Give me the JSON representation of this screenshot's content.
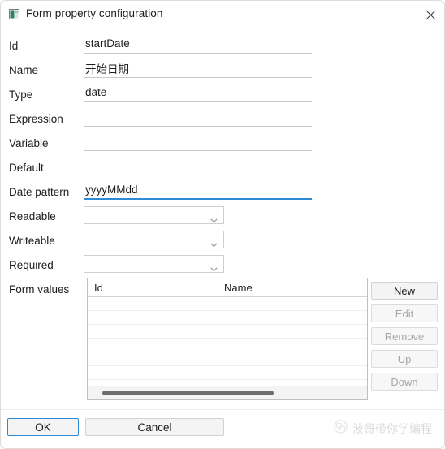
{
  "window": {
    "title": "Form property configuration",
    "icon": "app-window-icon",
    "close_icon": "close-icon",
    "accent_color": "#2f8ad6",
    "background": "#ffffff"
  },
  "form": {
    "rows": [
      {
        "label": "Id",
        "control": "text",
        "value": "startDate",
        "placeholder": "",
        "focused": false
      },
      {
        "label": "Name",
        "control": "text",
        "value": "开始日期",
        "placeholder": "",
        "focused": false
      },
      {
        "label": "Type",
        "control": "text",
        "value": "date",
        "placeholder": "",
        "focused": false
      },
      {
        "label": "Expression",
        "control": "text",
        "value": "",
        "placeholder": "",
        "focused": false
      },
      {
        "label": "Variable",
        "control": "text",
        "value": "",
        "placeholder": "",
        "focused": false
      },
      {
        "label": "Default",
        "control": "text",
        "value": "",
        "placeholder": "",
        "focused": false
      },
      {
        "label": "Date pattern",
        "control": "text",
        "value": "yyyyMMdd",
        "placeholder": "",
        "focused": true
      },
      {
        "label": "Readable",
        "control": "combo",
        "value": "",
        "placeholder": "",
        "focused": false
      },
      {
        "label": "Writeable",
        "control": "combo",
        "value": "",
        "placeholder": "",
        "focused": false
      },
      {
        "label": "Required",
        "control": "combo",
        "value": "",
        "placeholder": "",
        "focused": false
      }
    ],
    "form_values_label": "Form values"
  },
  "table": {
    "columns": [
      "Id",
      "Name"
    ],
    "rows": [],
    "empty_row_count": 6,
    "scrollbar": {
      "orientation": "horizontal",
      "visible": true
    }
  },
  "side_buttons": [
    {
      "label": "New",
      "enabled": true
    },
    {
      "label": "Edit",
      "enabled": false
    },
    {
      "label": "Remove",
      "enabled": false
    },
    {
      "label": "Up",
      "enabled": false
    },
    {
      "label": "Down",
      "enabled": false
    }
  ],
  "footer": {
    "ok_label": "OK",
    "cancel_label": "Cancel",
    "default_button": "OK"
  },
  "watermark": {
    "text": "波哥带你学编程",
    "icon": "wechat-logo-icon"
  }
}
